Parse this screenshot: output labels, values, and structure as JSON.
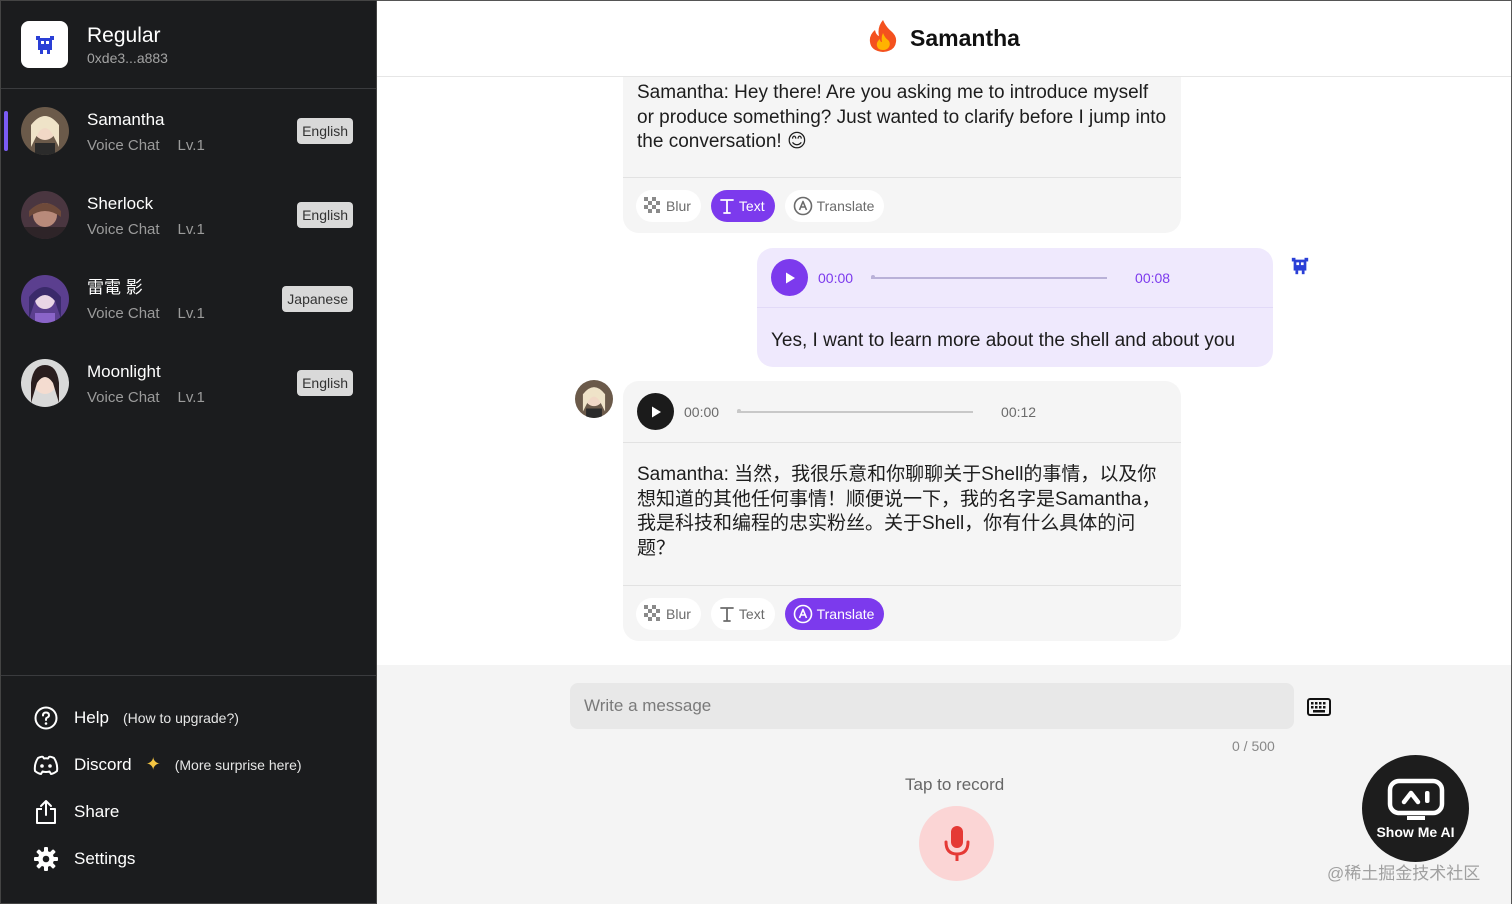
{
  "profile": {
    "name": "Regular",
    "address": "0xde3...a883"
  },
  "characters": [
    {
      "name": "Samantha",
      "type": "Voice Chat",
      "level": "Lv.1",
      "language": "English",
      "active": true
    },
    {
      "name": "Sherlock",
      "type": "Voice Chat",
      "level": "Lv.1",
      "language": "English",
      "active": false
    },
    {
      "name": "雷電 影",
      "type": "Voice Chat",
      "level": "Lv.1",
      "language": "Japanese",
      "active": false
    },
    {
      "name": "Moonlight",
      "type": "Voice Chat",
      "level": "Lv.1",
      "language": "English",
      "active": false
    }
  ],
  "side_links": {
    "help": "Help",
    "help_note": "(How to upgrade?)",
    "discord": "Discord",
    "discord_note": "(More surprise here)",
    "share": "Share",
    "settings": "Settings"
  },
  "chat": {
    "title": "Samantha",
    "messages": [
      {
        "text": "Samantha: Hey there! Are you asking me to introduce myself or produce something? Just wanted to clarify before I jump into the conversation! 😊",
        "tools": {
          "blur": "Blur",
          "text": "Text",
          "translate": "Translate"
        }
      },
      {
        "time_start": "00:00",
        "time_end": "00:08",
        "text": "Yes, I want to learn more about the shell and about you"
      },
      {
        "time_start": "00:00",
        "time_end": "00:12",
        "text": "Samantha: 当然，我很乐意和你聊聊关于Shell的事情，以及你想知道的其他任何事情！顺便说一下，我的名字是Samantha，我是科技和编程的忠实粉丝。关于Shell，你有什么具体的问题？",
        "tools": {
          "blur": "Blur",
          "text": "Text",
          "translate": "Translate"
        }
      }
    ]
  },
  "composer": {
    "placeholder": "Write a message",
    "counter": "0 / 500",
    "tap_label": "Tap to record"
  },
  "watermark": {
    "logo_text": "Show Me AI",
    "credit": "@稀土掘金技术社区"
  },
  "colors": {
    "accent": "#7c3aed",
    "sidebar_bg": "#1b1c1e",
    "mic_bg": "#fbd5d5",
    "mic_icon": "#e53935"
  }
}
